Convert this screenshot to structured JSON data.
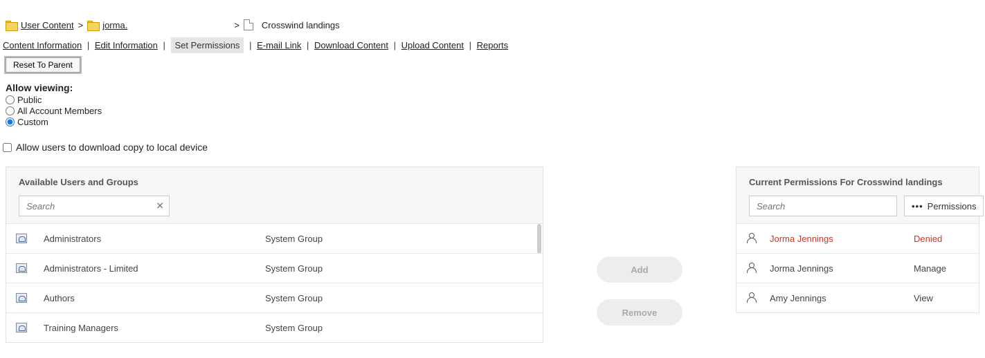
{
  "breadcrumb": {
    "items": [
      {
        "label": "User Content"
      },
      {
        "label": "jorma."
      }
    ],
    "current": "Crosswind landings"
  },
  "tabs": {
    "content_info": "Content Information",
    "edit_info": "Edit Information",
    "set_permissions": "Set Permissions",
    "email_link": "E-mail Link",
    "download_content": "Download Content",
    "upload_content": "Upload Content",
    "reports": "Reports"
  },
  "reset_button": "Reset To Parent",
  "allow_viewing": {
    "title": "Allow viewing:",
    "public": "Public",
    "all_members": "All Account Members",
    "custom": "Custom",
    "selected": "custom"
  },
  "download_checkbox": "Allow users to download copy to local device",
  "left_panel": {
    "title": "Available Users and Groups",
    "search_placeholder": "Search",
    "rows": [
      {
        "name": "Administrators",
        "type": "System Group"
      },
      {
        "name": "Administrators - Limited",
        "type": "System Group"
      },
      {
        "name": "Authors",
        "type": "System Group"
      },
      {
        "name": "Training Managers",
        "type": "System Group"
      }
    ]
  },
  "middle": {
    "add": "Add",
    "remove": "Remove"
  },
  "right_panel": {
    "title": "Current Permissions For Crosswind landings",
    "search_placeholder": "Search",
    "permissions_btn": "Permissions",
    "rows": [
      {
        "name": "Jorma Jennings",
        "perm": "Denied",
        "denied": true
      },
      {
        "name": "Jorma Jennings",
        "perm": "Manage",
        "denied": false
      },
      {
        "name": "Amy Jennings",
        "perm": "View",
        "denied": false
      }
    ]
  }
}
